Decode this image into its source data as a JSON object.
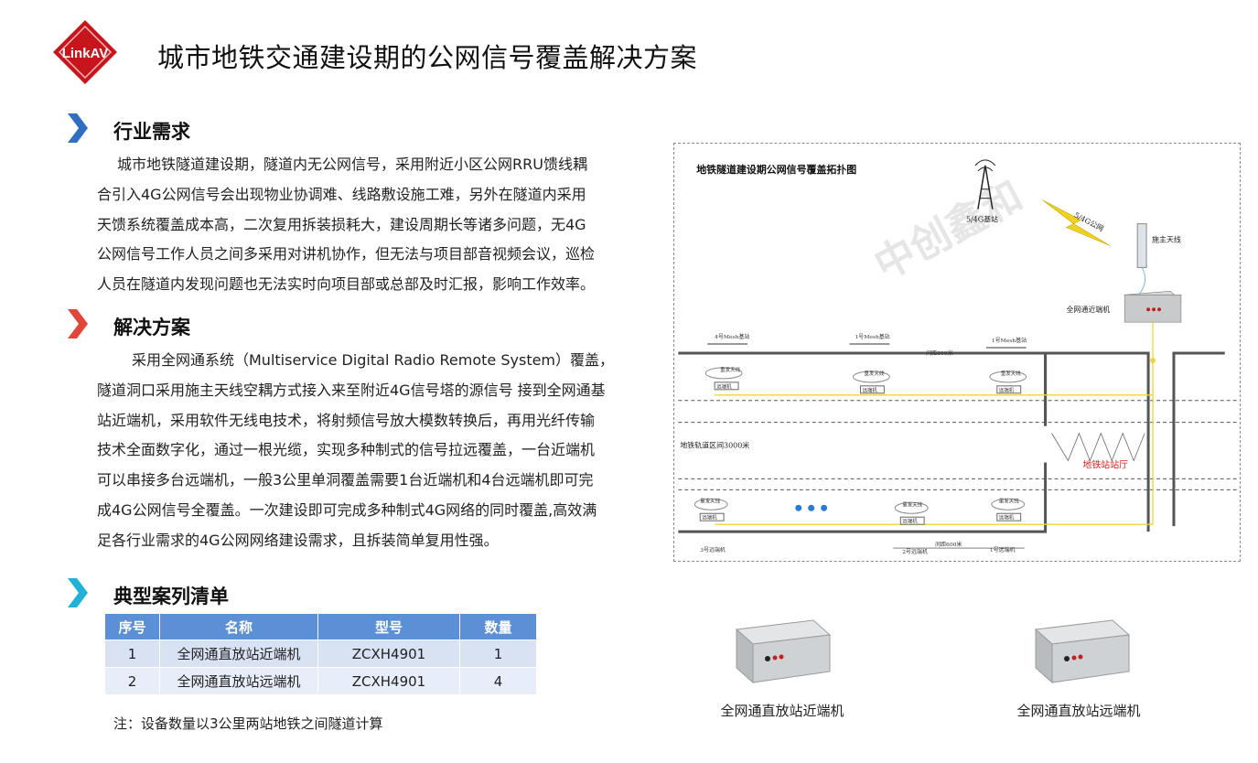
{
  "header": {
    "logo_text": "LinkAV",
    "title": "城市地铁交通建设期的公网信号覆盖解决方案"
  },
  "sections": {
    "industry": {
      "title": "行业需求",
      "lines": [
        "城市地铁隧道建设期，隧道内无公网信号，采用附近小区公网RRU馈线耦",
        "合引入4G公网信号会出现物业协调难、线路敷设施工难，另外在隧道内采用",
        "天馈系统覆盖成本高，二次复用拆装损耗大，建设周期长等诸多问题，无4G",
        "公网信号工作人员之间多采用对讲机协作，但无法与项目部音视频会议，巡检",
        "人员在隧道内发现问题也无法实时向项目部或总部及时汇报，影响工作效率。"
      ]
    },
    "solution": {
      "title": "解决方案",
      "lines": [
        "采用全网通系统（Multiservice Digital Radio Remote System）覆盖，",
        "隧道洞口采用施主天线空耦方式接入来至附近4G信号塔的源信号 接到全网通基",
        "站近端机，采用软件无线电技术，将射频信号放大模数转换后，再用光纤传输",
        "技术全面数字化，通过一根光缆，实现多种制式的信号拉远覆盖，一台近端机",
        "可以串接多台远端机，一般3公里单洞覆盖需要1台近端机和4台远端机即可完",
        "成4G公网信号全覆盖。一次建设即可完成多种制式4G网络的同时覆盖,高效满",
        "足各行业需求的4G公网网络建设需求，且拆装简单复用性强。"
      ]
    },
    "cases": {
      "title": "典型案列清单",
      "columns": [
        "序号",
        "名称",
        "型号",
        "数量"
      ],
      "rows": [
        [
          "1",
          "全网通直放站近端机",
          "ZCXH4901",
          "1"
        ],
        [
          "2",
          "全网通直放站远端机",
          "ZCXH4901",
          "4"
        ]
      ],
      "note": "注：设备数量以3公里两站地铁之间隧道计算"
    }
  },
  "diagram": {
    "title": "地铁隧道建设期公网信号覆盖拓扑图",
    "watermark": "中创鑫和",
    "base_station": "5/4G基站",
    "wireless_label": "5/4G公网",
    "donor_antenna": "施主天线",
    "near_unit": "全网通近端机",
    "mesh_4": "4号Mesh基站",
    "mesh_1a": "1号Mesh基站",
    "mesh_1b": "1号Mesh基站",
    "spacing_top": "间距300米",
    "spacing_bottom": "间距600米",
    "track_section": "地铁轨道区间3000米",
    "station_hall": "地铁站站厅",
    "antenna_label": "重发天线",
    "remote_label": "远端机",
    "bottom_3": "3号远端机",
    "bottom_2": "2号远端机",
    "bottom_1": "1号远端机",
    "colors": {
      "fiber": "#f2d33a",
      "station": "#e02020",
      "rail": "#555555"
    }
  },
  "devices": [
    {
      "caption": "全网通直放站近端机"
    },
    {
      "caption": "全网通直放站远端机"
    }
  ]
}
